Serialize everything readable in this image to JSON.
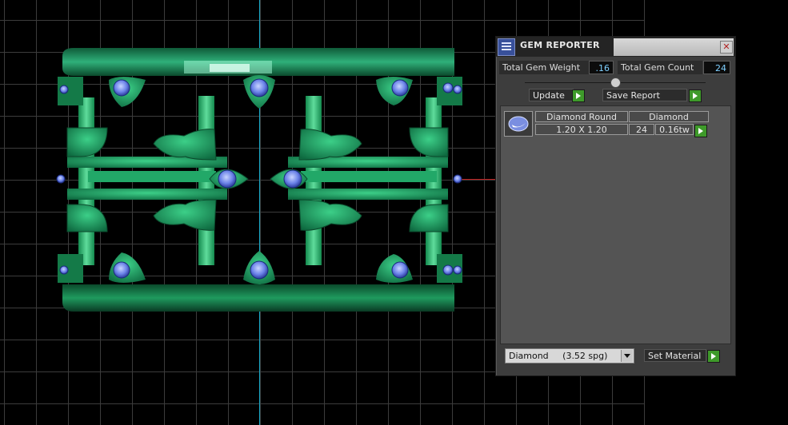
{
  "colors": {
    "viewport_bg": "#000000",
    "grid_line": "#3c3c3c",
    "axis_vertical": "#18a8c8",
    "axis_horizontal": "#c02020",
    "metal": "#1f9a5e",
    "metal_highlight": "#7ff0c0",
    "gem": "#6a82e8",
    "panel_bg": "#3d3d3d",
    "value_text": "#7fd0ff",
    "go_button": "#3e9a2a"
  },
  "panel": {
    "title": "GEM REPORTER",
    "close_icon": "close-icon",
    "total_gem_weight_label": "Total Gem Weight",
    "total_gem_weight_value": ".16",
    "total_gem_count_label": "Total Gem Count",
    "total_gem_count_value": "24",
    "update_label": "Update",
    "save_report_label": "Save Report",
    "gem_row": {
      "shape": "Diamond Round",
      "size": "1.20 X 1.20",
      "type": "Diamond",
      "count": "24",
      "weight": "0.16tw"
    },
    "material_select_value": "Diamond     (3.52 spg)",
    "set_material_label": "Set Material"
  }
}
